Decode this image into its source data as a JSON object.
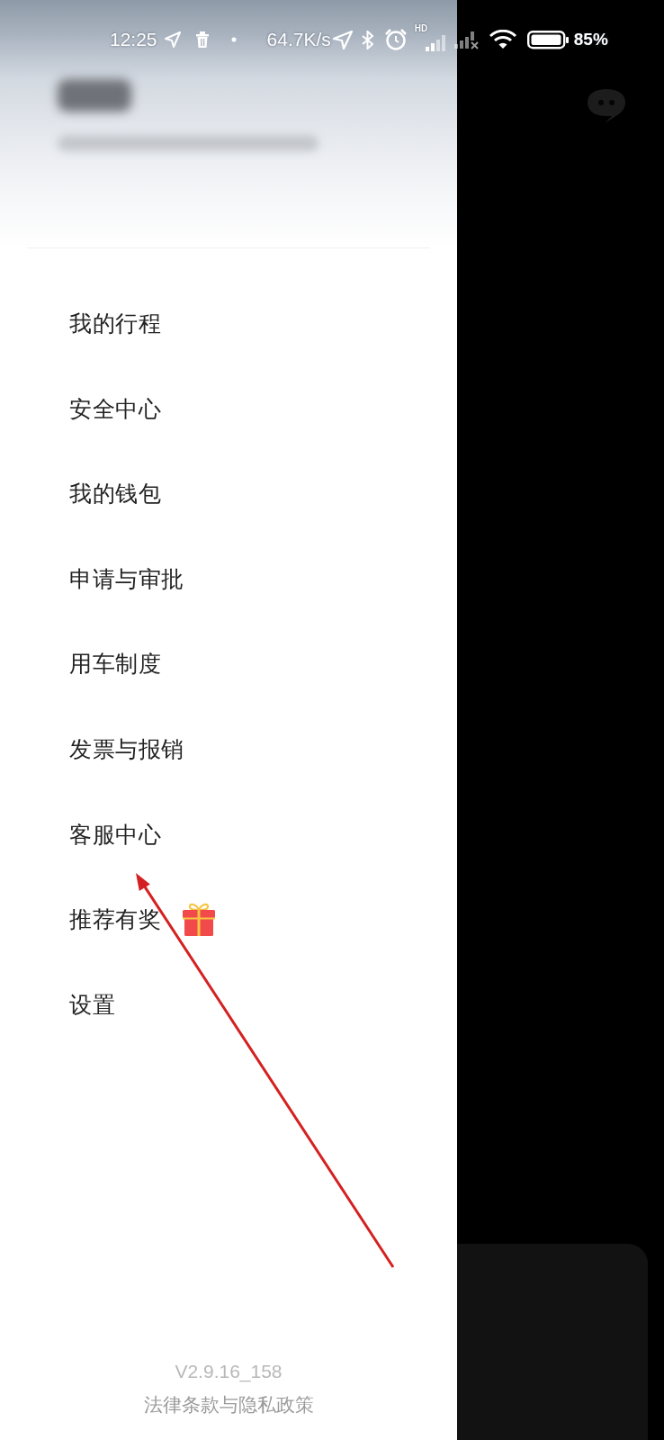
{
  "status_bar": {
    "time": "12:25",
    "network_speed": "64.7K/s",
    "signal_label": "HD",
    "battery": "85%"
  },
  "drawer": {
    "menu": [
      {
        "label": "我的行程",
        "kind": "plain"
      },
      {
        "label": "安全中心",
        "kind": "plain"
      },
      {
        "label": "我的钱包",
        "kind": "plain"
      },
      {
        "label": "申请与审批",
        "kind": "plain"
      },
      {
        "label": "用车制度",
        "kind": "plain"
      },
      {
        "label": "发票与报销",
        "kind": "plain"
      },
      {
        "label": "客服中心",
        "kind": "plain"
      },
      {
        "label": "推荐有奖",
        "kind": "gift"
      },
      {
        "label": "设置",
        "kind": "plain"
      }
    ],
    "footer": {
      "version": "V2.9.16_158",
      "legal_link": "法律条款与隐私政策"
    }
  }
}
